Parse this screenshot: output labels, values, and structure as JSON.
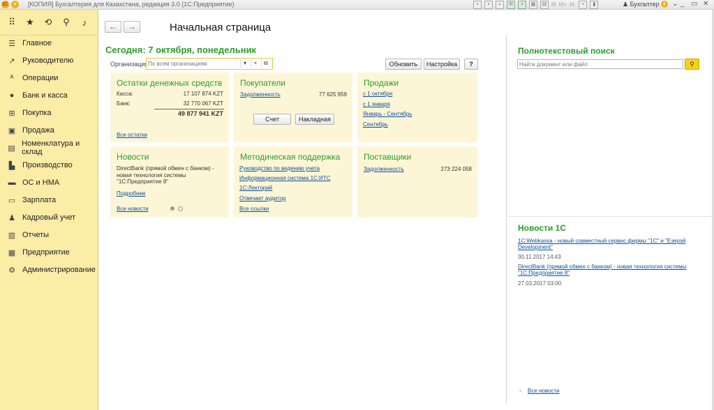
{
  "titlebar": {
    "title": "[КОПИЯ] Бухгалтерия для Казахстана, редакция 3.0  (1С:Предприятие)",
    "m_labels": [
      "M",
      "M+",
      "M-"
    ],
    "user": "Бухгалтер",
    "info": "i",
    "win_controls": [
      "_",
      "▭",
      "✕"
    ]
  },
  "sidebar": {
    "top_icons": [
      "apps-grid-icon",
      "star-icon",
      "history-icon",
      "search-icon",
      "bell-icon"
    ],
    "items": [
      {
        "label": "Главное",
        "icon": "menu-lines-icon",
        "glyph": "☰"
      },
      {
        "label": "Руководителю",
        "icon": "trend-icon",
        "glyph": "↗"
      },
      {
        "label": "Операции",
        "icon": "operations-icon",
        "glyph": "ᴬ"
      },
      {
        "label": "Банк и касса",
        "icon": "bank-icon",
        "glyph": "●"
      },
      {
        "label": "Покупка",
        "icon": "cart-icon",
        "glyph": "⊞"
      },
      {
        "label": "Продажа",
        "icon": "bag-icon",
        "glyph": "▣"
      },
      {
        "label": "Номенклатура и склад",
        "icon": "warehouse-icon",
        "glyph": "▤"
      },
      {
        "label": "Производство",
        "icon": "factory-icon",
        "glyph": "▙"
      },
      {
        "label": "ОС и НМА",
        "icon": "truck-icon",
        "glyph": "▬"
      },
      {
        "label": "Зарплата",
        "icon": "wallet-icon",
        "glyph": "▭"
      },
      {
        "label": "Кадровый учет",
        "icon": "people-icon",
        "glyph": "♟"
      },
      {
        "label": "Отчеты",
        "icon": "report-chart-icon",
        "glyph": "▥"
      },
      {
        "label": "Предприятие",
        "icon": "building-icon",
        "glyph": "▦"
      },
      {
        "label": "Администрирование",
        "icon": "gear-icon",
        "glyph": "⚙"
      }
    ]
  },
  "main": {
    "page_title": "Начальная страница",
    "today": "Сегодня: 7 октября, понедельник",
    "org_label": "Организация:",
    "org_placeholder": "По всем организациям",
    "refresh": "Обновить",
    "settings": "Настройка",
    "help": "?"
  },
  "panels": {
    "cash": {
      "title": "Остатки денежных средств",
      "kassa_label": "Касса:",
      "kassa_value": "17 107 874 KZT",
      "bank_label": "Банк:",
      "bank_value": "32 770 067 KZT",
      "total": "49 877 941 KZT",
      "all_link": "Все остатки"
    },
    "buyers": {
      "title": "Покупатели",
      "debt_label": "Задолженность",
      "debt_value": "77 625 959",
      "btn_invoice": "Счет",
      "btn_waybill": "Накладная"
    },
    "sales": {
      "title": "Продажи",
      "links": [
        "с 1 октября",
        "с 1 января",
        "Январь - Сентябрь",
        "Сентябрь"
      ]
    },
    "news": {
      "title": "Новости",
      "text1": "DirectBank (прямой обмен с банком) -",
      "text2": "новая технология системы",
      "text3": "\"1С:Предприятие 8\"",
      "more": "Подробнее",
      "all": "Все новости"
    },
    "method": {
      "title": "Методическая поддержка",
      "links": [
        "Руководство по ведению учета",
        "Информационная система 1С:ИТС",
        "1С:Лекторий",
        "Отвечает аудитор",
        "Все ссылки"
      ]
    },
    "suppliers": {
      "title": "Поставщики",
      "debt_label": "Задолженность",
      "debt_value": "273 224 058"
    }
  },
  "right": {
    "fts_title": "Полнотекстовый поиск",
    "fts_placeholder": "Найти документ или файл",
    "news_title": "Новости 1С",
    "news": [
      {
        "line1": "1С:Webkassa - новый совместный сервис фирмы \"1С\" и \"Езерэй",
        "line2": "Development\"",
        "date": "30.11.2017 14:43"
      },
      {
        "line1": "DirectBank (прямой обмен с банком) - новая технология системы",
        "line2": "\"1С:Предприятие 8\"",
        "date": "27.03.2017 03:00"
      }
    ],
    "all_news": "Все новости"
  },
  "colors": {
    "accent_green": "#2a9d2a",
    "sidebar": "#fbeca6",
    "panel": "#fdf6d6",
    "link": "#0e4e9c",
    "yellow": "#f4d313"
  }
}
